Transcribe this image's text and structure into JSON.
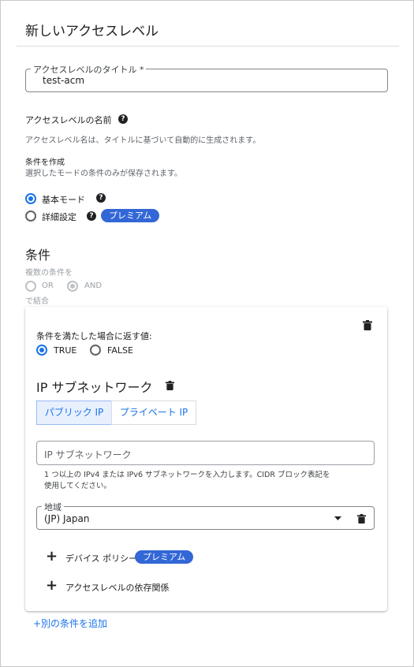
{
  "header": {
    "title": "新しいアクセスレベル"
  },
  "title_field": {
    "label": "アクセスレベルのタイトル *",
    "value": "test-acm"
  },
  "name_section": {
    "label": "アクセスレベルの名前",
    "help_glyph": "?",
    "description": "アクセスレベル名は、タイトルに基づいて自動的に生成されます。"
  },
  "create_conditions": {
    "label": "条件を作成",
    "description": "選択したモードの条件のみが保存されます。",
    "modes": [
      {
        "label": "基本モード",
        "selected": true
      },
      {
        "label": "詳細設定",
        "selected": false,
        "badge": "プレミアム"
      }
    ]
  },
  "conditions": {
    "heading": "条件",
    "combine_prefix": "複数の条件を",
    "combine_suffix": "で結合",
    "options": [
      "OR",
      "AND"
    ],
    "selected": "AND",
    "card": {
      "return_label": "条件を満たした場合に返す値:",
      "return_options": [
        "TRUE",
        "FALSE"
      ],
      "return_selected": "TRUE",
      "ip_heading": "IP サブネットワーク",
      "ip_tabs": [
        "パブリック IP",
        "プライベート IP"
      ],
      "ip_tab_active": "パブリック IP",
      "ip_placeholder": "IP サブネットワーク",
      "ip_hint_line1": "1 つ以上の IPv4 または IPv6 サブネットワークを入力します。CIDR ブロック表記を",
      "ip_hint_line2": "使用してください。",
      "region_label": "地域",
      "region_value": "(JP) Japan",
      "device_policy_label": "デバイス ポリシー",
      "device_policy_badge": "プレミアム",
      "dependency_label": "アクセスレベルの依存関係",
      "plus_glyph": "+"
    },
    "add_condition_link": "+別の条件を追加"
  },
  "colors": {
    "accent": "#1a73e8",
    "premium_badge": "#3367d6",
    "text": "#202124"
  },
  "icons": [
    "help-icon",
    "delete-icon",
    "dropdown-arrow-icon",
    "plus-icon"
  ]
}
